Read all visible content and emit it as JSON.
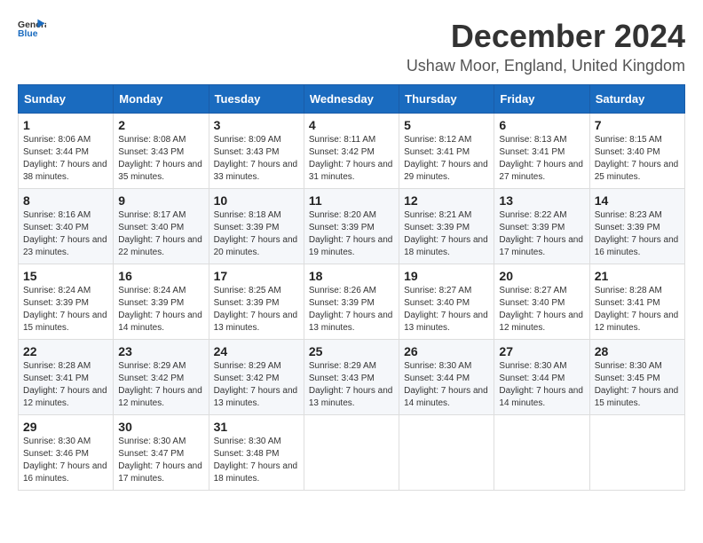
{
  "logo": {
    "general": "General",
    "blue": "Blue"
  },
  "title": "December 2024",
  "subtitle": "Ushaw Moor, England, United Kingdom",
  "days_of_week": [
    "Sunday",
    "Monday",
    "Tuesday",
    "Wednesday",
    "Thursday",
    "Friday",
    "Saturday"
  ],
  "weeks": [
    [
      {
        "day": "1",
        "sunrise": "Sunrise: 8:06 AM",
        "sunset": "Sunset: 3:44 PM",
        "daylight": "Daylight: 7 hours and 38 minutes."
      },
      {
        "day": "2",
        "sunrise": "Sunrise: 8:08 AM",
        "sunset": "Sunset: 3:43 PM",
        "daylight": "Daylight: 7 hours and 35 minutes."
      },
      {
        "day": "3",
        "sunrise": "Sunrise: 8:09 AM",
        "sunset": "Sunset: 3:43 PM",
        "daylight": "Daylight: 7 hours and 33 minutes."
      },
      {
        "day": "4",
        "sunrise": "Sunrise: 8:11 AM",
        "sunset": "Sunset: 3:42 PM",
        "daylight": "Daylight: 7 hours and 31 minutes."
      },
      {
        "day": "5",
        "sunrise": "Sunrise: 8:12 AM",
        "sunset": "Sunset: 3:41 PM",
        "daylight": "Daylight: 7 hours and 29 minutes."
      },
      {
        "day": "6",
        "sunrise": "Sunrise: 8:13 AM",
        "sunset": "Sunset: 3:41 PM",
        "daylight": "Daylight: 7 hours and 27 minutes."
      },
      {
        "day": "7",
        "sunrise": "Sunrise: 8:15 AM",
        "sunset": "Sunset: 3:40 PM",
        "daylight": "Daylight: 7 hours and 25 minutes."
      }
    ],
    [
      {
        "day": "8",
        "sunrise": "Sunrise: 8:16 AM",
        "sunset": "Sunset: 3:40 PM",
        "daylight": "Daylight: 7 hours and 23 minutes."
      },
      {
        "day": "9",
        "sunrise": "Sunrise: 8:17 AM",
        "sunset": "Sunset: 3:40 PM",
        "daylight": "Daylight: 7 hours and 22 minutes."
      },
      {
        "day": "10",
        "sunrise": "Sunrise: 8:18 AM",
        "sunset": "Sunset: 3:39 PM",
        "daylight": "Daylight: 7 hours and 20 minutes."
      },
      {
        "day": "11",
        "sunrise": "Sunrise: 8:20 AM",
        "sunset": "Sunset: 3:39 PM",
        "daylight": "Daylight: 7 hours and 19 minutes."
      },
      {
        "day": "12",
        "sunrise": "Sunrise: 8:21 AM",
        "sunset": "Sunset: 3:39 PM",
        "daylight": "Daylight: 7 hours and 18 minutes."
      },
      {
        "day": "13",
        "sunrise": "Sunrise: 8:22 AM",
        "sunset": "Sunset: 3:39 PM",
        "daylight": "Daylight: 7 hours and 17 minutes."
      },
      {
        "day": "14",
        "sunrise": "Sunrise: 8:23 AM",
        "sunset": "Sunset: 3:39 PM",
        "daylight": "Daylight: 7 hours and 16 minutes."
      }
    ],
    [
      {
        "day": "15",
        "sunrise": "Sunrise: 8:24 AM",
        "sunset": "Sunset: 3:39 PM",
        "daylight": "Daylight: 7 hours and 15 minutes."
      },
      {
        "day": "16",
        "sunrise": "Sunrise: 8:24 AM",
        "sunset": "Sunset: 3:39 PM",
        "daylight": "Daylight: 7 hours and 14 minutes."
      },
      {
        "day": "17",
        "sunrise": "Sunrise: 8:25 AM",
        "sunset": "Sunset: 3:39 PM",
        "daylight": "Daylight: 7 hours and 13 minutes."
      },
      {
        "day": "18",
        "sunrise": "Sunrise: 8:26 AM",
        "sunset": "Sunset: 3:39 PM",
        "daylight": "Daylight: 7 hours and 13 minutes."
      },
      {
        "day": "19",
        "sunrise": "Sunrise: 8:27 AM",
        "sunset": "Sunset: 3:40 PM",
        "daylight": "Daylight: 7 hours and 13 minutes."
      },
      {
        "day": "20",
        "sunrise": "Sunrise: 8:27 AM",
        "sunset": "Sunset: 3:40 PM",
        "daylight": "Daylight: 7 hours and 12 minutes."
      },
      {
        "day": "21",
        "sunrise": "Sunrise: 8:28 AM",
        "sunset": "Sunset: 3:41 PM",
        "daylight": "Daylight: 7 hours and 12 minutes."
      }
    ],
    [
      {
        "day": "22",
        "sunrise": "Sunrise: 8:28 AM",
        "sunset": "Sunset: 3:41 PM",
        "daylight": "Daylight: 7 hours and 12 minutes."
      },
      {
        "day": "23",
        "sunrise": "Sunrise: 8:29 AM",
        "sunset": "Sunset: 3:42 PM",
        "daylight": "Daylight: 7 hours and 12 minutes."
      },
      {
        "day": "24",
        "sunrise": "Sunrise: 8:29 AM",
        "sunset": "Sunset: 3:42 PM",
        "daylight": "Daylight: 7 hours and 13 minutes."
      },
      {
        "day": "25",
        "sunrise": "Sunrise: 8:29 AM",
        "sunset": "Sunset: 3:43 PM",
        "daylight": "Daylight: 7 hours and 13 minutes."
      },
      {
        "day": "26",
        "sunrise": "Sunrise: 8:30 AM",
        "sunset": "Sunset: 3:44 PM",
        "daylight": "Daylight: 7 hours and 14 minutes."
      },
      {
        "day": "27",
        "sunrise": "Sunrise: 8:30 AM",
        "sunset": "Sunset: 3:44 PM",
        "daylight": "Daylight: 7 hours and 14 minutes."
      },
      {
        "day": "28",
        "sunrise": "Sunrise: 8:30 AM",
        "sunset": "Sunset: 3:45 PM",
        "daylight": "Daylight: 7 hours and 15 minutes."
      }
    ],
    [
      {
        "day": "29",
        "sunrise": "Sunrise: 8:30 AM",
        "sunset": "Sunset: 3:46 PM",
        "daylight": "Daylight: 7 hours and 16 minutes."
      },
      {
        "day": "30",
        "sunrise": "Sunrise: 8:30 AM",
        "sunset": "Sunset: 3:47 PM",
        "daylight": "Daylight: 7 hours and 17 minutes."
      },
      {
        "day": "31",
        "sunrise": "Sunrise: 8:30 AM",
        "sunset": "Sunset: 3:48 PM",
        "daylight": "Daylight: 7 hours and 18 minutes."
      },
      null,
      null,
      null,
      null
    ]
  ]
}
